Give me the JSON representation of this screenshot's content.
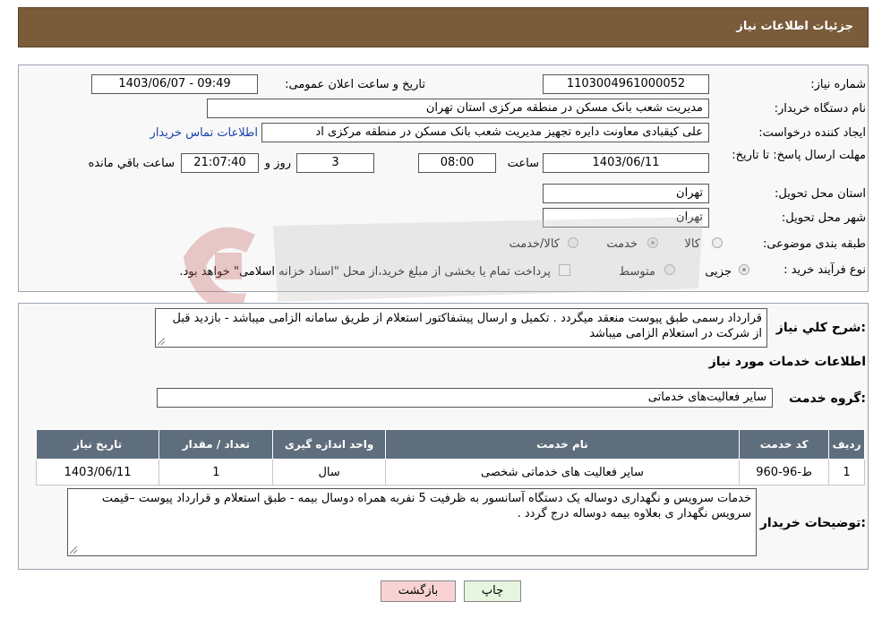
{
  "header": {
    "title": "جزئیات اطلاعات نیاز"
  },
  "fields": {
    "need_number_label": "شماره نیاز:",
    "need_number": "1103004961000052",
    "announce_label": "تاریخ و ساعت اعلان عمومی:",
    "announce_value": "1403/06/07 - 09:49",
    "buyer_label": "نام دستگاه خریدار:",
    "buyer_value": "مدیریت شعب بانک مسکن در منطقه مرکزی استان تهران",
    "creator_label": "ایجاد کننده درخواست:",
    "creator_value": "علی کیقبادی معاونت دایره تجهیز مدیریت شعب بانک مسکن در منطقه مرکزی اد",
    "contact_link": "اطلاعات تماس خریدار",
    "deadline_label": "مهلت ارسال پاسخ: تا تاریخ:",
    "deadline_date": "1403/06/11",
    "time_label": "ساعت",
    "deadline_time": "08:00",
    "days_value": "3",
    "days_label": "روز و",
    "remaining_time": "21:07:40",
    "remaining_label": "ساعت باقي مانده",
    "province_label": "استان محل تحویل:",
    "province_value": "تهران",
    "city_label": "شهر محل تحویل:",
    "city_value": "تهران",
    "category_label": "طبقه بندی موضوعی:",
    "category_options": [
      "کالا",
      "خدمت",
      "کالا/خدمت"
    ],
    "process_label": "نوع فرآیند خرید :",
    "process_options": [
      "جزیی",
      "متوسط"
    ],
    "payment_note": "پرداخت تمام یا بخشی از مبلغ خرید،از محل \"اسناد خزانه اسلامی\" خواهد بود."
  },
  "description": {
    "label": "شرح كلي نياز:",
    "text": "قرارداد رسمی طبق پیوست منعقد میگردد .  تکمیل و ارسال پیشفاکتور استعلام از طریق  سامانه الزامی میباشد - بازدید قبل از شرکت در استعلام الزامی میباشد"
  },
  "services": {
    "section_title": "اطلاعات خدمات مورد نياز",
    "group_label": "گروه خدمت:",
    "group_value": "سایر فعالیت‌های خدماتی",
    "columns": [
      "رديف",
      "كد خدمت",
      "نام خدمت",
      "واحد اندازه گيری",
      "تعداد / مقدار",
      "تاريخ نياز"
    ],
    "rows": [
      [
        "1",
        "ط-96-960",
        "سایر فعالیت های خدماتی شخصی",
        "سال",
        "1",
        "1403/06/11"
      ]
    ]
  },
  "buyer_notes": {
    "label": "توضیحات خریدار:",
    "text": "خدمات سرویس و نگهداری  دوساله یک دستگاه آسانسور  به ظرفیت 5 نفربه همراه دوسال بیمه - طبق استعلام و قرارداد پیوست –قیمت سرویس نگهدار ی بعلاوه بیمه دوساله درج گردد ."
  },
  "buttons": {
    "print": "چاپ",
    "back": "بازگشت"
  },
  "colors": {
    "header": "#7a5b3a",
    "table_header": "#5f6e7c",
    "back_button": "#f9d3d3",
    "print_button": "#e6f5e0"
  }
}
